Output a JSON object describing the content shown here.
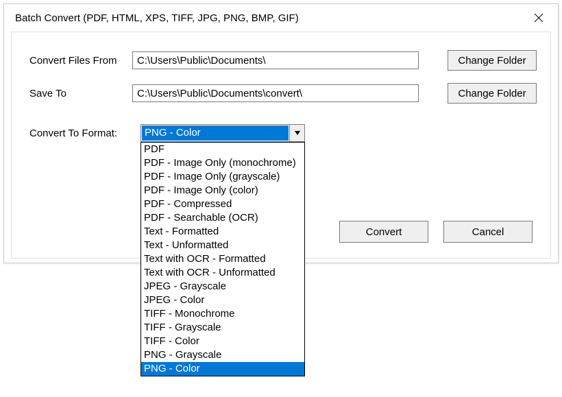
{
  "window": {
    "title": "Batch Convert (PDF, HTML, XPS, TIFF, JPG, PNG, BMP, GIF)"
  },
  "labels": {
    "convert_from": "Convert Files From",
    "save_to": "Save To",
    "format": "Convert To Format:"
  },
  "inputs": {
    "convert_from": "C:\\Users\\Public\\Documents\\",
    "save_to": "C:\\Users\\Public\\Documents\\convert\\"
  },
  "buttons": {
    "change_folder": "Change Folder",
    "convert": "Convert",
    "cancel": "Cancel"
  },
  "format": {
    "selected": "PNG - Color",
    "options": [
      "PDF",
      "PDF - Image Only (monochrome)",
      "PDF - Image Only (grayscale)",
      "PDF - Image Only (color)",
      "PDF - Compressed",
      "PDF - Searchable (OCR)",
      "Text - Formatted",
      "Text - Unformatted",
      "Text with OCR - Formatted",
      "Text with OCR - Unformatted",
      "JPEG - Grayscale",
      "JPEG - Color",
      "TIFF - Monochrome",
      "TIFF - Grayscale",
      "TIFF - Color",
      "PNG - Grayscale",
      "PNG - Color"
    ]
  }
}
